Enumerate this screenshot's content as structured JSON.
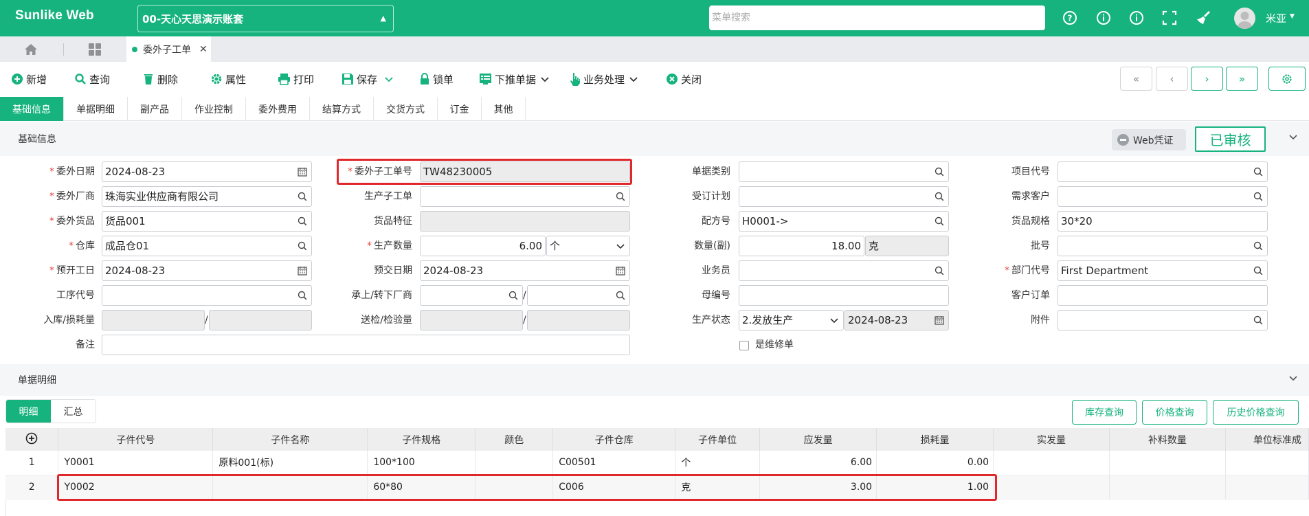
{
  "app": {
    "brand": "Sunlike Web",
    "account": "00-天心天思演示账套",
    "menu_search_placeholder": "菜单搜索",
    "user_name": "米亚"
  },
  "tabs": {
    "open_doc": "委外子工单"
  },
  "toolbar": {
    "add": "新增",
    "query": "查询",
    "delete": "删除",
    "properties": "属性",
    "print": "打印",
    "save": "保存",
    "lock": "锁单",
    "push_down": "下推单据",
    "business": "业务处理",
    "close": "关闭"
  },
  "section_tabs": [
    "基础信息",
    "单据明细",
    "副产品",
    "作业控制",
    "委外费用",
    "结算方式",
    "交货方式",
    "订金",
    "其他"
  ],
  "basic": {
    "title": "基础信息",
    "web_voucher": "Web凭证",
    "status": "已审核"
  },
  "form": {
    "labels": {
      "wwrq": "委外日期",
      "wwcs": "委外厂商",
      "wwhp": "委外货品",
      "ck": "仓库",
      "ykgr": "预开工日",
      "gxdh": "工序代号",
      "rkshl": "入库/损耗量",
      "bz": "备注",
      "wwzgdh": "委外子工单号",
      "sczgd": "生产子工单",
      "hptz": "货品特征",
      "scsl": "生产数量",
      "yjrq": "预交日期",
      "szxcs": "承上/转下厂商",
      "sjjyl": "送检/检验量",
      "djlb": "单据类别",
      "ddjh": "受订计划",
      "pfh": "配方号",
      "slf": "数量(副)",
      "ywy": "业务员",
      "mbh": "母编号",
      "sczt": "生产状态",
      "sfwxd": "是维修单",
      "xmdh": "项目代号",
      "xqkh": "需求客户",
      "hpgg": "货品规格",
      "ph": "批号",
      "bmdh": "部门代号",
      "khdd": "客户订单",
      "fj": "附件"
    },
    "values": {
      "wwrq": "2024-08-23",
      "wwcs": "珠海实业供应商有限公司",
      "wwhp": "货品001",
      "ck": "成品仓01",
      "ykgr": "2024-08-23",
      "wwzgdh": "TW48230005",
      "scsl": "6.00",
      "scsl_unit": "个",
      "yjrq": "2024-08-23",
      "pfh": "H0001->",
      "slf": "18.00",
      "slf_unit": "克",
      "sczt": "2.发放生产",
      "sczt_date": "2024-08-23",
      "hpgg": "30*20",
      "bmdh": "First Department"
    },
    "slash": "/"
  },
  "detail": {
    "title": "单据明细",
    "subtabs": [
      "明细",
      "汇总"
    ],
    "buttons": [
      "库存查询",
      "价格查询",
      "历史价格查询"
    ],
    "columns": [
      "子件代号",
      "子件名称",
      "子件规格",
      "颜色",
      "子件仓库",
      "子件单位",
      "应发量",
      "损耗量",
      "实发量",
      "补料数量",
      "单位标准成"
    ],
    "rows": [
      {
        "no": "1",
        "code": "Y0001",
        "name": "原料001(标)",
        "spec": "100*100",
        "color": "",
        "wh": "C00501",
        "unit": "个",
        "qty": "6.00",
        "loss": "0.00",
        "actual": "",
        "supp": "",
        "std": ""
      },
      {
        "no": "2",
        "code": "Y0002",
        "name": "",
        "spec": "60*80",
        "color": "",
        "wh": "C006",
        "unit": "克",
        "qty": "3.00",
        "loss": "1.00",
        "actual": "",
        "supp": "",
        "std": ""
      }
    ]
  },
  "icons": {
    "help": "help-circle-icon",
    "info": "info-circle-icon",
    "about": "info-circle-icon",
    "fullscreen": "fullscreen-icon",
    "clean": "broom-icon"
  },
  "colors": {
    "brand": "#16b37e",
    "required": "#e0443b",
    "highlight": "#e0282c"
  }
}
